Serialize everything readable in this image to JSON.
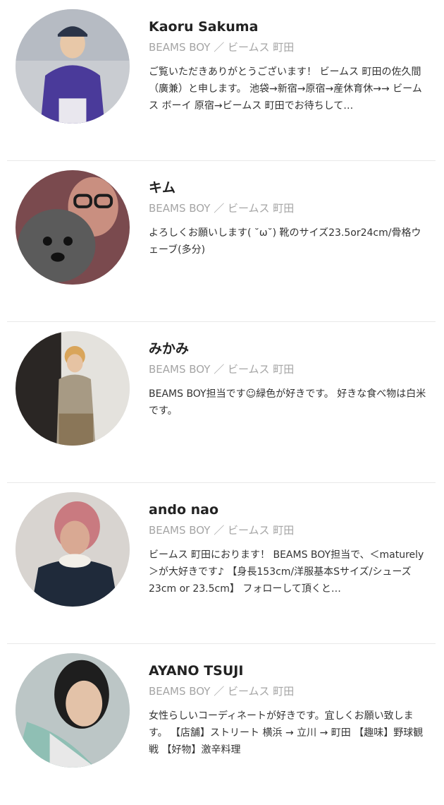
{
  "staff": [
    {
      "name": "Kaoru Sakuma",
      "shop": "BEAMS BOY ／ ビームス 町田",
      "bio": "ご覧いただきありがとうございます！ ビームス 町田の佐久間（廣兼）と申します。 池袋→新宿→原宿→産休育休→→ ビームス ボーイ 原宿→ビームス 町田でお待ちして…",
      "avatar_icon": "staff-photo"
    },
    {
      "name": "キム",
      "shop": "BEAMS BOY ／ ビームス 町田",
      "bio": "よろしくお願いします( ˘ω˘)  靴のサイズ23.5or24cm/骨格ウェーブ(多分)",
      "avatar_icon": "staff-photo"
    },
    {
      "name": "みかみ",
      "shop": "BEAMS BOY ／ ビームス 町田",
      "bio": "BEAMS BOY担当です☺︎緑色が好きです。 好きな食べ物は白米です。",
      "avatar_icon": "staff-photo"
    },
    {
      "name": "ando nao",
      "shop": "BEAMS BOY ／ ビームス 町田",
      "bio": "ビームス 町田におります！ BEAMS BOY担当で、＜maturely＞が大好きです♪ 【身長153cm/洋服基本Sサイズ/シューズ23cm or 23.5cm】 フォローして頂くと…",
      "avatar_icon": "staff-photo"
    },
    {
      "name": "AYANO TSUJI",
      "shop": "BEAMS BOY ／ ビームス 町田",
      "bio": "女性らしいコーディネートが好きです。宜しくお願い致します。 【店舗】ストリート 横浜 → 立川 → 町田 【趣味】野球観戦 【好物】激辛料理",
      "avatar_icon": "staff-photo"
    }
  ],
  "colors": {
    "name": "#222222",
    "shop": "#a5a5a5",
    "bio": "#333333",
    "divider": "#e9e9e9"
  }
}
